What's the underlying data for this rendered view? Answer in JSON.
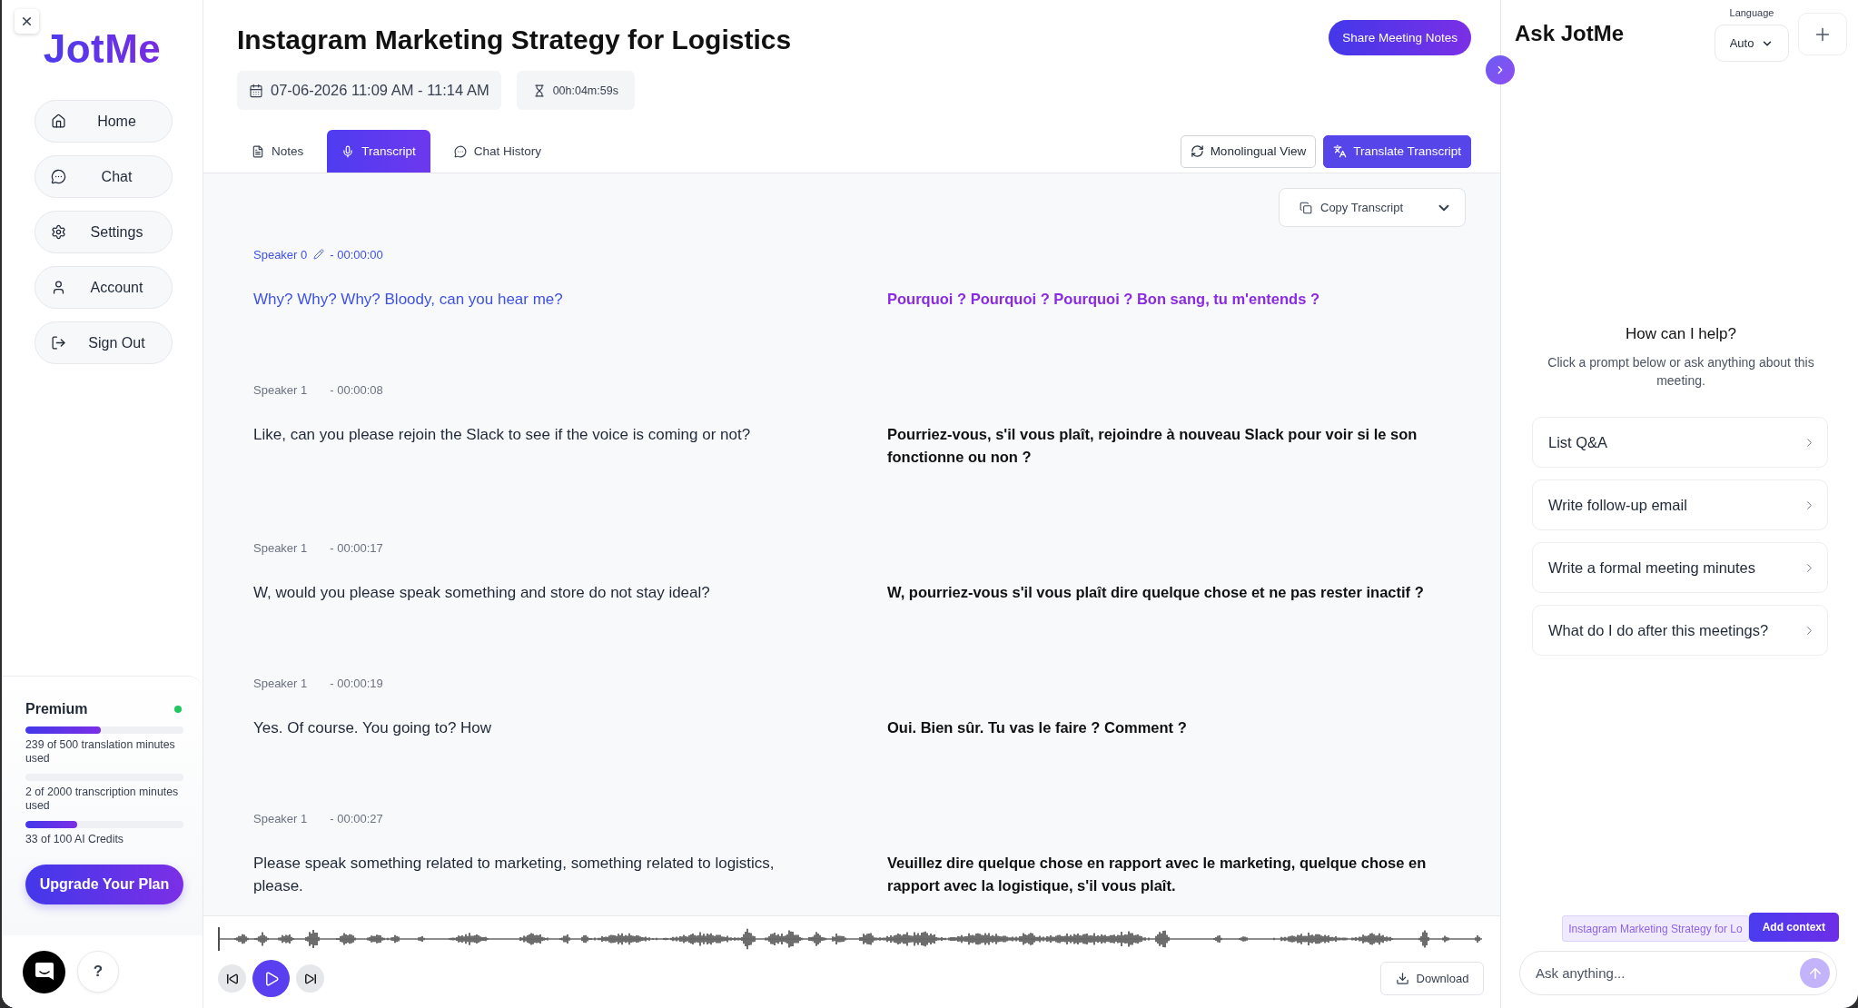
{
  "sidebar": {
    "logo": "JotMe",
    "nav": [
      "Home",
      "Chat",
      "Settings",
      "Account",
      "Sign Out"
    ],
    "plan": {
      "name": "Premium",
      "active": true,
      "usage": [
        {
          "label": "239 of 500 translation minutes used",
          "level": 0.478
        },
        {
          "label": "2 of 2000 transcription minutes used",
          "level": 0.001
        },
        {
          "label": "33 of 100 AI Credits",
          "level": 0.33
        }
      ],
      "upgrade_button": "Upgrade Your Plan"
    },
    "help_button": "?"
  },
  "meeting": {
    "title": "Instagram Marketing Strategy for Logistics",
    "share_button": "Share Meeting Notes",
    "date": "07-06-2026 11:09 AM - 11:14 AM",
    "duration": "00h:04m:59s"
  },
  "tabs": [
    {
      "label": "Notes",
      "selected": false
    },
    {
      "label": "Transcript",
      "selected": true
    },
    {
      "label": "Chat History",
      "selected": false
    }
  ],
  "view_buttons": [
    {
      "label": "Monolingual View",
      "selected": false
    },
    {
      "label": "Translate Transcript",
      "selected": true
    }
  ],
  "copy_button": "Copy Transcript",
  "transcript": [
    {
      "speaker": "Speaker 0",
      "time": "- 00:00:00",
      "active": true,
      "text": "Why? Why? Why? Bloody, can you hear me?",
      "translation": "Pourquoi ? Pourquoi ? Pourquoi ? Bon sang, tu m'entends ?"
    },
    {
      "speaker": "Speaker 1",
      "time": "- 00:00:08",
      "active": false,
      "text": "Like, can you please rejoin the Slack to see if the voice is coming or not?",
      "translation": "Pourriez-vous, s'il vous plaît, rejoindre à nouveau Slack pour voir si le son fonctionne ou non ?"
    },
    {
      "speaker": "Speaker 1",
      "time": "- 00:00:17",
      "active": false,
      "text": "W, would you please speak something and store do not stay ideal?",
      "translation": "W, pourriez-vous s'il vous plaît dire quelque chose et ne pas rester inactif ?"
    },
    {
      "speaker": "Speaker 1",
      "time": "- 00:00:19",
      "active": false,
      "text": "Yes. Of course. You going to? How",
      "translation": "Oui. Bien sûr. Tu vas le faire ? Comment ?"
    },
    {
      "speaker": "Speaker 1",
      "time": "- 00:00:27",
      "active": false,
      "text": "Please speak something related to marketing, something related to logistics, please.",
      "translation": "Veuillez dire quelque chose en rapport avec le marketing, quelque chose en rapport avec la logistique, s'il vous plaît."
    }
  ],
  "player": {
    "playing": false,
    "download_button": "Download"
  },
  "assistant": {
    "title": "Ask JotMe",
    "language_label": "Language",
    "language": "Auto",
    "help_title": "How can I help?",
    "help_text": "Click a prompt below or ask anything about this meeting.",
    "prompts": [
      "List Q&A",
      "Write follow-up email",
      "Write a formal meeting minutes",
      "What do I do after this meetings?"
    ],
    "context_chip": "Instagram Marketing Strategy for Lo",
    "add_context_button": "Add context",
    "input_placeholder": "Ask anything..."
  }
}
